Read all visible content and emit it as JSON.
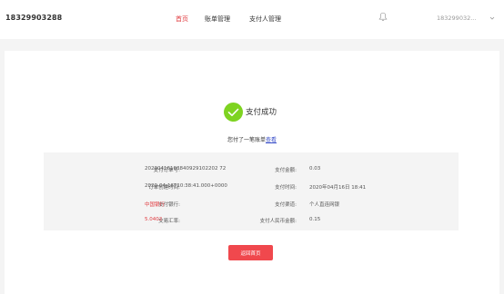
{
  "header": {
    "brand": "18329903288",
    "nav": {
      "home": "首页",
      "bills": "账单管理",
      "payers": "支付人管理"
    },
    "user": "183299032..."
  },
  "result": {
    "title": "支付成功",
    "subtitle_prefix": "您付了一笔账单",
    "subtitle_link": "查看"
  },
  "details": {
    "order_no_label": "支付订单号:",
    "order_no": "20200416103840929102202 72",
    "created_label": "订单创建时间:",
    "created": "2020-04-16T10:38:41.000+0000",
    "bank_label": "支付银行:",
    "bank": "中国银行",
    "rate_label": "交易汇率:",
    "rate": "5.0402",
    "amount_label": "支付金额:",
    "amount": "0.03",
    "time_label": "支付时间:",
    "time": "2020年04月16日 18:41",
    "channel_label": "支付渠道:",
    "channel": "个人直连网银",
    "rmb_label": "支付人民币金额:",
    "rmb": "0.15"
  },
  "actions": {
    "return_home": "返回首页"
  },
  "colors": {
    "accent": "#e0393e",
    "success": "#7ed321",
    "link": "#3a4fc9"
  }
}
